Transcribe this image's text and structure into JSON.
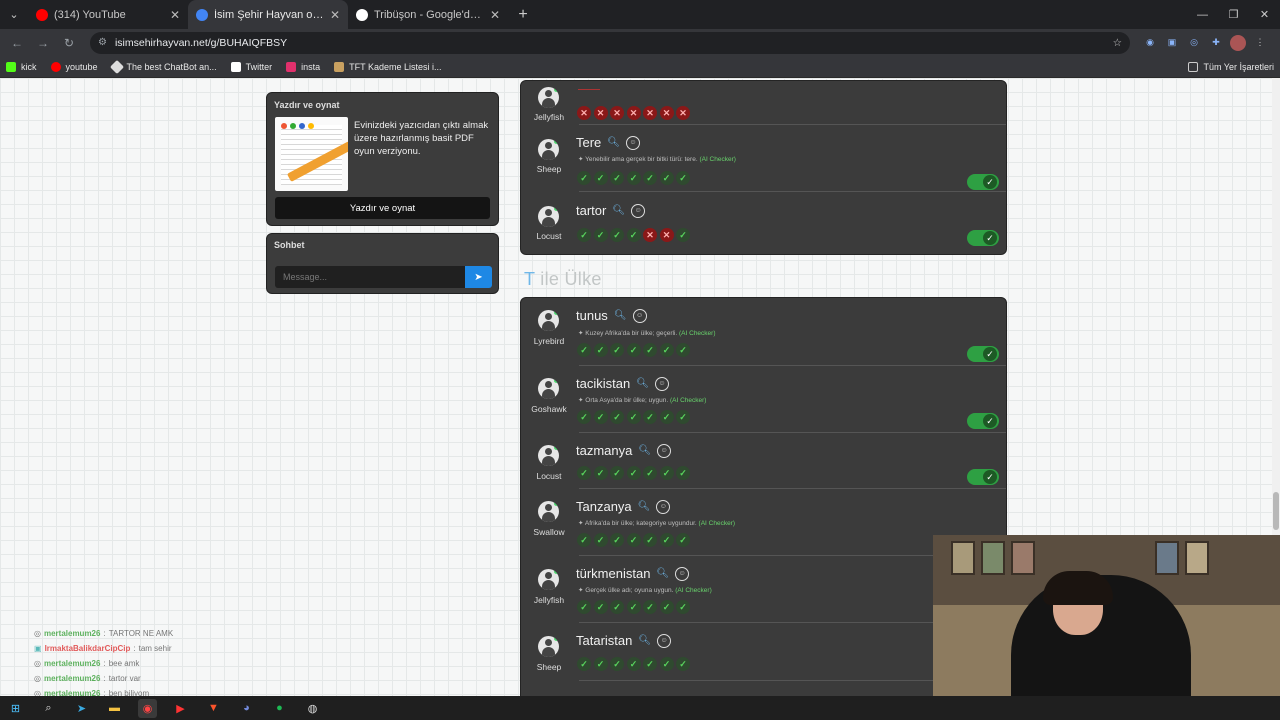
{
  "browser": {
    "tabs": [
      {
        "title": "(314) YouTube",
        "color": "#ff0000"
      },
      {
        "title": "İsim Şehir Hayvan oyununa katıl",
        "color": "#4285f4"
      },
      {
        "title": "Tribüşon - Google'da Ara",
        "color": "#ffffff"
      }
    ],
    "url": "isimsehirhayvan.net/g/BUHAIQFBSY",
    "bookmarks": [
      {
        "label": "kick",
        "color": "#53fc18"
      },
      {
        "label": "youtube",
        "color": "#ff0000"
      },
      {
        "label": "The best ChatBot an...",
        "color": "#dddddd"
      },
      {
        "label": "Twitter",
        "color": "#ffffff"
      },
      {
        "label": "insta",
        "color": "#e1306c"
      },
      {
        "label": "TFT Kademe Listesi i...",
        "color": "#c8a060"
      }
    ],
    "bookmarks_right": "Tüm Yer İşaretleri"
  },
  "sidebar": {
    "print": {
      "title": "Yazdır ve oynat",
      "text": "Evinizdeki yazıcıdan çıktı almak üzere hazırlanmış basit PDF oyun verziyonu.",
      "button": "Yazdır ve oynat"
    },
    "chat": {
      "title": "Sohbet",
      "placeholder": "Message..."
    }
  },
  "panel1": {
    "rows": [
      {
        "user": "Jellyfish",
        "word": "",
        "note": "",
        "votes": [
          "no",
          "no",
          "no",
          "no",
          "no",
          "no",
          "no"
        ],
        "accepted": false
      },
      {
        "user": "Sheep",
        "word": "Tere",
        "note": "Yenebilir ama gerçek bir bitki türü: tere.",
        "votes": [
          "ok",
          "ok",
          "ok",
          "ok",
          "ok",
          "ok",
          "ok"
        ],
        "accepted": true
      },
      {
        "user": "Locust",
        "word": "tartor",
        "note": "",
        "votes": [
          "ok",
          "ok",
          "ok",
          "ok",
          "no",
          "no",
          "ok"
        ],
        "accepted": true
      }
    ]
  },
  "section_title": {
    "first": "T",
    "rest": " ile Ülke"
  },
  "panel2": {
    "rows": [
      {
        "user": "Lyrebird",
        "word": "tunus",
        "note": "Kuzey Afrika'da bir ülke; geçerli.",
        "accepted": true
      },
      {
        "user": "Goshawk",
        "word": "tacikistan",
        "note": "Orta Asya'da bir ülke; uygun.",
        "accepted": true
      },
      {
        "user": "Locust",
        "word": "tazmanya",
        "note": "",
        "accepted": true
      },
      {
        "user": "Swallow",
        "word": "Tanzanya",
        "note": "Afrika'da bir ülke; kategoriye uygundur.",
        "accepted": false
      },
      {
        "user": "Jellyfish",
        "word": "türkmenistan",
        "note": "Gerçek ülke adı; oyuna uygun.",
        "accepted": false
      },
      {
        "user": "Sheep",
        "word": "Tataristan",
        "note": "",
        "accepted": false
      }
    ],
    "ai_label": "(AI Checker)"
  },
  "chatlog": [
    {
      "user": "mertalemum26",
      "msg": "TARTOR NE AMK",
      "red": false
    },
    {
      "user": "IrmaktaBalikdarCipCip",
      "msg": "tam sehir",
      "red": true
    },
    {
      "user": "mertalemum26",
      "msg": "bee amk",
      "red": false
    },
    {
      "user": "mertalemum26",
      "msg": "tartor var",
      "red": false
    },
    {
      "user": "mertalemum26",
      "msg": "ben biliyom",
      "red": false
    }
  ]
}
